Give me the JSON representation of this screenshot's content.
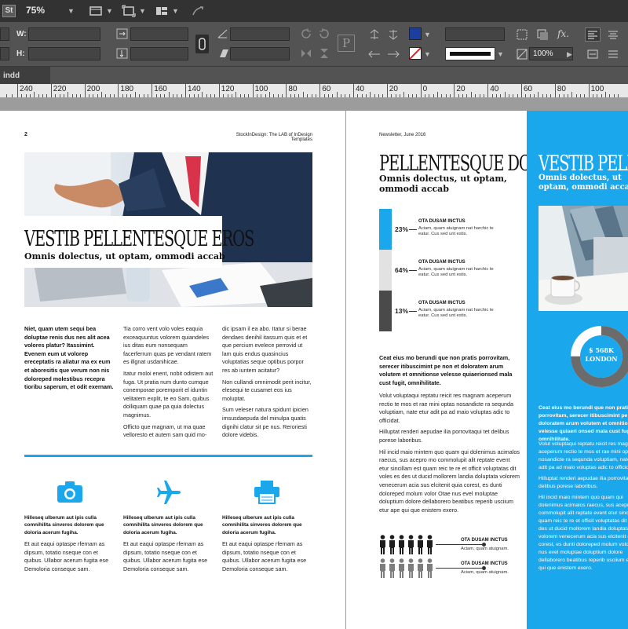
{
  "app": {
    "logo": "St",
    "zoom": "75%",
    "colors": {
      "accent_blue": "#1aa7ec",
      "appbar": "#323232",
      "panel": "#535353",
      "swatch_blue": "#1c3f9e"
    }
  },
  "control_panel": {
    "w_label": "W:",
    "h_label": "H:",
    "stroke_weight": "",
    "scale_percent": "100%"
  },
  "document_tab": {
    "label": "indd"
  },
  "ruler": {
    "labels": [
      "240",
      "220",
      "200",
      "180",
      "160",
      "140",
      "120",
      "100",
      "80",
      "60",
      "40",
      "20",
      "0",
      "20",
      "40",
      "60",
      "80",
      "100"
    ]
  },
  "left_page": {
    "page_number": "2",
    "running_header": "StockInDesign: The LAB of InDesign Templates",
    "title": "VESTIB PELLENTESQUE EROS",
    "subtitle": "Omnis dolectus, ut optam, ommodi accab",
    "col1_lead": "Niet, quam utem sequi bea doluptae renis dus nes alit acea volores platur? Itassimint. Evenem eum ut volorep ereceptatis ra aliatur ma ex eum et aboresitis que verum non nis doloreped molestibus recepra tioribu saperum, et odit exernam.",
    "col2_p1": "Tia corro vent volo voles eaquia exceaquuntus volorem quiandeles ius ditas eum nonsequam facerferrum quas pe vendant ratem es illgnat usdanihicae.",
    "col2_p2": "Itatur moloi enent, nobit odistem aut fuga. Ut pratia num dunto cumque conemporae poremporit el iduntin velitatem explit, te eo Sam, quibus dolliquam quae pa quia dolectus magnimus.",
    "col2_p3": "Officto que magnam, ut ma quae velloresto et autem sam quid mo-",
    "col3_p1": "dic ipsam il ea abo. Itatur si berae dendaes denihil itassum quis et et que percium evelece perrovid ut lam quis endus quasincius voluptatias seque optibus porpor res ab iuntem acitatur?",
    "col3_p2": "Non cullandi omnimodit perit incitur, elesequi te cusamet eos ius moluptat.",
    "col3_p3": "Sum veleser natura spidunt ipicien imsusdaepuda del minulpa quatis dignihi clatur sit pe nus. Reroriesti dolore videbis.",
    "features": [
      {
        "icon": "camera-icon",
        "title": "Hilleseq ulberum aut ipis culla comnihilita sinveres dolorem que doloria acerum fugiha.",
        "body": "Et aut eaqui optaspe rfernam as dipsum, totatio nseque con et quibus. Ullabor acerum fugita ese Demoloria conseque sam."
      },
      {
        "icon": "airplane-icon",
        "title": "Hilleseq ulberum aut ipis culla comnihilita sinveres dolorem que doloria acerum fugiha.",
        "body": "Et aut eaqui optaspe rfernam as dipsum, totatio nseque con et quibus. Ullabor acerum fugita ese Demoloria conseque sam."
      },
      {
        "icon": "printer-icon",
        "title": "Hilleseq ulberum aut ipis culla comnihilita sinveres dolorem que doloria acerum fugiha.",
        "body": "Et aut eaqui optaspe rfernam as dipsum, totatio nseque con et quibus. Ullabor acerum fugita ese Demoloria conseque sam."
      }
    ]
  },
  "right_page": {
    "running_header": "Newsletter, June 2016",
    "title": "PELLENTESQUE DOR",
    "subtitle": "Omnis dolectus, ut optam, ommodi accab",
    "stats": [
      {
        "value": "23%",
        "fraction": 0.23,
        "color": "#1aa7ec",
        "label": "OTA DUSAM INCTUS",
        "text": "Aciam, quam atuignam nat harchic te eatur. Cus sed unt estis."
      },
      {
        "value": "64%",
        "fraction": 0.64,
        "color": "#e2e2e2",
        "label": "OTA DUSAM INCTUS",
        "text": "Aciam, quam atuignam nat harchic te eatur. Cus sed unt estis."
      },
      {
        "value": "13%",
        "fraction": 0.13,
        "color": "#4a4a4a",
        "label": "OTA DUSAM INCTUS",
        "text": "Aciam, quam atuignam nat harchic te eatur. Cus sed unt estis."
      }
    ],
    "lead": "Ceat eius mo berundi que non pratis porrovitam, serecer itibuscimint pe non et doloratem arum volutem et omnitionse velesse quiaerionsed mala cust fugit, omnihilitate.",
    "p1": "Volut voluptaqui reptatu reicit res magnam aceperum rectio te mos et rae mini optas nosandicte ra sequnda voluptiam, nate etur adit pa ad maio voluptas adic to officidat.",
    "p2": "Hilluptat renderi aepudae ilia porrovitaqui tet delibus porese laboribus.",
    "p3": "Hil incid maio mintem quo quam qui dolenimus acimalos raecus, sus acepro mo commolupit alit reptate event etur sincillam est quam reic te re et officit voluptatas dit voles es des ut ducid mollorem landia doluptata volorem venecerum acia sus elcitenit quia corest, es dunti doloreped molum volor Otae nus evel moluptae doluptium dolore dellaborero beatibus reperib usciium etur ape qui que enistem exero.",
    "people": [
      {
        "label": "OTA DUSAM INCTUS",
        "text": "Aciam, quam atuignam."
      },
      {
        "label": "OTA DUSAM INCTUS",
        "text": "Aciam, quam atuignam."
      }
    ],
    "blue_col": {
      "title": "VESTIB PELLEN",
      "subtitle": "Omnis dolectus, ut optam, ommodi accab",
      "donut_value": "$ 568K",
      "donut_label": "LONDON",
      "donut_fraction": 0.75,
      "lead": "Ceat eius mo berundi que non pratis porrovitam, serecer itibuscimint pe non et doloratem arum volutem et omnitionse velesse quiaeri onsed mala cust fugit, omnihilitate.",
      "p1": "Volut voluptaqui reptatu reicit res magnam aceperum rectio te mos et rae mini optas nosandicte ra sequnda voluptiam, nate etur adit pa ad maio voluptas adic to officidat.",
      "p2": "Hilluptat renderi aepudae ilia porrovitaqui tet delibus porese laboribus.",
      "p3": "Hil incid maio mintem quo quam qui dolenimus acimalos raecus, sus acepro mo commolupit alit reptate event etur sincillam est quam reic te re et officit voluptatas dit voles es des ut ducid mollorem landia doluptata volorem venecerum acia sus elcitenit quia corest, es dunti doloreped molum volor Otae nus evel moluptae doluptium dolore dellaborero beatibus reperib usciium etur ape qui que enistem exero."
    }
  }
}
